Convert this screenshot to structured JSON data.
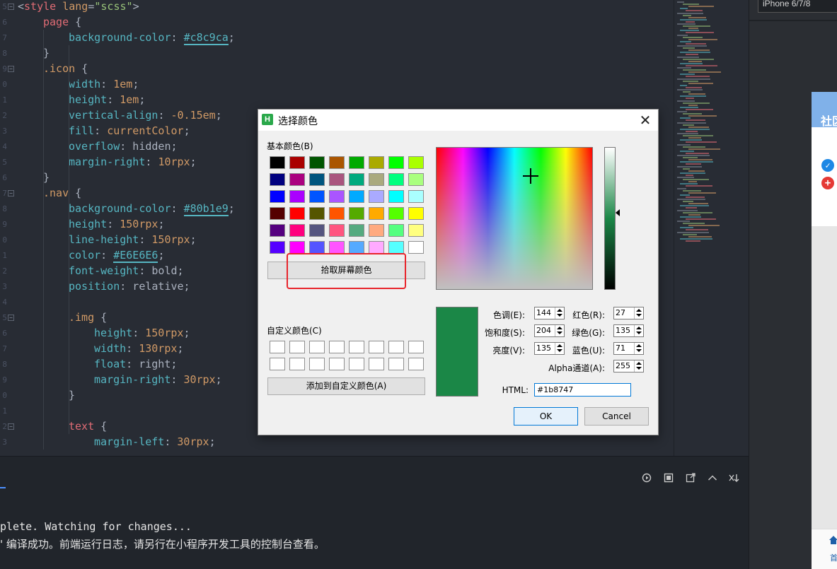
{
  "editor": {
    "line_numbers": [
      "5",
      "6",
      "7",
      "8",
      "9",
      "0",
      "1",
      "2",
      "3",
      "4",
      "5",
      "6",
      "7",
      "8",
      "9",
      "0",
      "1",
      "2",
      "3",
      "4",
      "5",
      "6",
      "7",
      "8",
      "9",
      "0",
      "1",
      "2",
      "3"
    ],
    "lines": [
      {
        "indent": 0,
        "tokens": [
          {
            "t": "p",
            "v": "<"
          },
          {
            "t": "tag",
            "v": "style"
          },
          {
            "t": "p",
            "v": " "
          },
          {
            "t": "attr",
            "v": "lang"
          },
          {
            "t": "p",
            "v": "="
          },
          {
            "t": "str",
            "v": "\"scss\""
          },
          {
            "t": "p",
            "v": ">"
          }
        ]
      },
      {
        "indent": 1,
        "tokens": [
          {
            "t": "sel",
            "v": "page"
          },
          {
            "t": "p",
            "v": " {"
          }
        ]
      },
      {
        "indent": 2,
        "tokens": [
          {
            "t": "prop",
            "v": "background-color"
          },
          {
            "t": "p",
            "v": ": "
          },
          {
            "t": "hex",
            "v": "#c8c9ca"
          },
          {
            "t": "p",
            "v": ";"
          }
        ]
      },
      {
        "indent": 1,
        "tokens": [
          {
            "t": "p",
            "v": "}"
          }
        ]
      },
      {
        "indent": 1,
        "tokens": [
          {
            "t": "cls",
            "v": ".icon"
          },
          {
            "t": "p",
            "v": " {"
          }
        ]
      },
      {
        "indent": 2,
        "tokens": [
          {
            "t": "prop",
            "v": "width"
          },
          {
            "t": "p",
            "v": ": "
          },
          {
            "t": "val",
            "v": "1em"
          },
          {
            "t": "p",
            "v": ";"
          }
        ]
      },
      {
        "indent": 2,
        "tokens": [
          {
            "t": "prop",
            "v": "height"
          },
          {
            "t": "p",
            "v": ": "
          },
          {
            "t": "val",
            "v": "1em"
          },
          {
            "t": "p",
            "v": ";"
          }
        ]
      },
      {
        "indent": 2,
        "tokens": [
          {
            "t": "prop",
            "v": "vertical-align"
          },
          {
            "t": "p",
            "v": ": "
          },
          {
            "t": "val",
            "v": "-0.15em"
          },
          {
            "t": "p",
            "v": ";"
          }
        ]
      },
      {
        "indent": 2,
        "tokens": [
          {
            "t": "prop",
            "v": "fill"
          },
          {
            "t": "p",
            "v": ": "
          },
          {
            "t": "val",
            "v": "currentColor"
          },
          {
            "t": "p",
            "v": ";"
          }
        ]
      },
      {
        "indent": 2,
        "tokens": [
          {
            "t": "prop",
            "v": "overflow"
          },
          {
            "t": "p",
            "v": ": hidden;"
          }
        ]
      },
      {
        "indent": 2,
        "tokens": [
          {
            "t": "prop",
            "v": "margin-right"
          },
          {
            "t": "p",
            "v": ": "
          },
          {
            "t": "val",
            "v": "10rpx"
          },
          {
            "t": "p",
            "v": ";"
          }
        ]
      },
      {
        "indent": 1,
        "tokens": [
          {
            "t": "p",
            "v": "}"
          }
        ]
      },
      {
        "indent": 1,
        "tokens": [
          {
            "t": "cls",
            "v": ".nav"
          },
          {
            "t": "p",
            "v": " {"
          }
        ]
      },
      {
        "indent": 2,
        "tokens": [
          {
            "t": "prop",
            "v": "background-color"
          },
          {
            "t": "p",
            "v": ": "
          },
          {
            "t": "hex",
            "v": "#80b1e9"
          },
          {
            "t": "p",
            "v": ";"
          }
        ]
      },
      {
        "indent": 2,
        "tokens": [
          {
            "t": "prop",
            "v": "height"
          },
          {
            "t": "p",
            "v": ": "
          },
          {
            "t": "val",
            "v": "150rpx"
          },
          {
            "t": "p",
            "v": ";"
          }
        ]
      },
      {
        "indent": 2,
        "tokens": [
          {
            "t": "prop",
            "v": "line-height"
          },
          {
            "t": "p",
            "v": ": "
          },
          {
            "t": "val",
            "v": "150rpx"
          },
          {
            "t": "p",
            "v": ";"
          }
        ]
      },
      {
        "indent": 2,
        "tokens": [
          {
            "t": "prop",
            "v": "color"
          },
          {
            "t": "p",
            "v": ": "
          },
          {
            "t": "hex",
            "v": "#E6E6E6"
          },
          {
            "t": "p",
            "v": ";"
          }
        ]
      },
      {
        "indent": 2,
        "tokens": [
          {
            "t": "prop",
            "v": "font-weight"
          },
          {
            "t": "p",
            "v": ": bold;"
          }
        ]
      },
      {
        "indent": 2,
        "tokens": [
          {
            "t": "prop",
            "v": "position"
          },
          {
            "t": "p",
            "v": ": relative;"
          }
        ]
      },
      {
        "indent": 0,
        "tokens": []
      },
      {
        "indent": 2,
        "tokens": [
          {
            "t": "cls",
            "v": ".img"
          },
          {
            "t": "p",
            "v": " {"
          }
        ]
      },
      {
        "indent": 3,
        "tokens": [
          {
            "t": "prop",
            "v": "height"
          },
          {
            "t": "p",
            "v": ": "
          },
          {
            "t": "val",
            "v": "150rpx"
          },
          {
            "t": "p",
            "v": ";"
          }
        ]
      },
      {
        "indent": 3,
        "tokens": [
          {
            "t": "prop",
            "v": "width"
          },
          {
            "t": "p",
            "v": ": "
          },
          {
            "t": "val",
            "v": "130rpx"
          },
          {
            "t": "p",
            "v": ";"
          }
        ]
      },
      {
        "indent": 3,
        "tokens": [
          {
            "t": "prop",
            "v": "float"
          },
          {
            "t": "p",
            "v": ": right;"
          }
        ]
      },
      {
        "indent": 3,
        "tokens": [
          {
            "t": "prop",
            "v": "margin-right"
          },
          {
            "t": "p",
            "v": ": "
          },
          {
            "t": "val",
            "v": "30rpx"
          },
          {
            "t": "p",
            "v": ";"
          }
        ]
      },
      {
        "indent": 2,
        "tokens": [
          {
            "t": "p",
            "v": "}"
          }
        ]
      },
      {
        "indent": 0,
        "tokens": []
      },
      {
        "indent": 2,
        "tokens": [
          {
            "t": "sel",
            "v": "text"
          },
          {
            "t": "p",
            "v": " {"
          }
        ]
      },
      {
        "indent": 3,
        "tokens": [
          {
            "t": "prop",
            "v": "margin-left"
          },
          {
            "t": "p",
            "v": ": "
          },
          {
            "t": "val",
            "v": "30rpx"
          },
          {
            "t": "p",
            "v": ";"
          }
        ]
      }
    ]
  },
  "right_panel": {
    "device_label": "iPhone 6/7/8",
    "nav_title": "社区",
    "check_icon": "checkmark-circle-icon",
    "plus_icon": "plus-circle-icon",
    "home_icon": "home-icon",
    "home_label": "首"
  },
  "console": {
    "line1": "plete. Watching for changes...",
    "line2": "' 编译成功。前端运行日志，请另行在小程序开发工具的控制台查看。",
    "tools": [
      "restart-icon",
      "stop-icon",
      "open-external-icon",
      "collapse-icon",
      "clear-icon"
    ]
  },
  "dialog": {
    "title": "选择颜色",
    "close_label": "✕",
    "basic_colors_label": "基本颜色(B)",
    "basic_colors": [
      [
        "#000000",
        "#aa0000",
        "#005500",
        "#aa5500",
        "#00aa00",
        "#aaaa00",
        "#00ff00",
        "#aaff00"
      ],
      [
        "#00007f",
        "#aa007f",
        "#00557f",
        "#aa557f",
        "#00aa7f",
        "#aaaa7f",
        "#00ff7f",
        "#aaff7f"
      ],
      [
        "#0000ff",
        "#aa00ff",
        "#0055ff",
        "#aa55ff",
        "#00aaff",
        "#aaaaff",
        "#00ffff",
        "#aaffff"
      ],
      [
        "#550000",
        "#ff0000",
        "#555500",
        "#ff5500",
        "#55aa00",
        "#ffaa00",
        "#55ff00",
        "#ffff00"
      ],
      [
        "#55007f",
        "#ff007f",
        "#55557f",
        "#ff557f",
        "#55aa7f",
        "#ffaa7f",
        "#55ff7f",
        "#ffff7f"
      ],
      [
        "#5500ff",
        "#ff00ff",
        "#5555ff",
        "#ff55ff",
        "#55aaff",
        "#ffaaff",
        "#55ffff",
        "#ffffff"
      ]
    ],
    "pick_screen_color": "拾取屏幕颜色",
    "custom_colors_label": "自定义颜色(C)",
    "add_custom_color": "添加到自定义颜色(A)",
    "current_color": "#1b8747",
    "fields": {
      "hue": {
        "label": "色调(E):",
        "value": "144"
      },
      "saturation": {
        "label": "饱和度(S):",
        "value": "204"
      },
      "value": {
        "label": "亮度(V):",
        "value": "135"
      },
      "red": {
        "label": "红色(R):",
        "value": "27"
      },
      "green": {
        "label": "绿色(G):",
        "value": "135"
      },
      "blue": {
        "label": "蓝色(U):",
        "value": "71"
      },
      "alpha": {
        "label": "Alpha通道(A):",
        "value": "255"
      }
    },
    "html_label": "HTML:",
    "html_value": "#1b8747",
    "ok": "OK",
    "cancel": "Cancel",
    "highlight_color": "#e8242b"
  }
}
